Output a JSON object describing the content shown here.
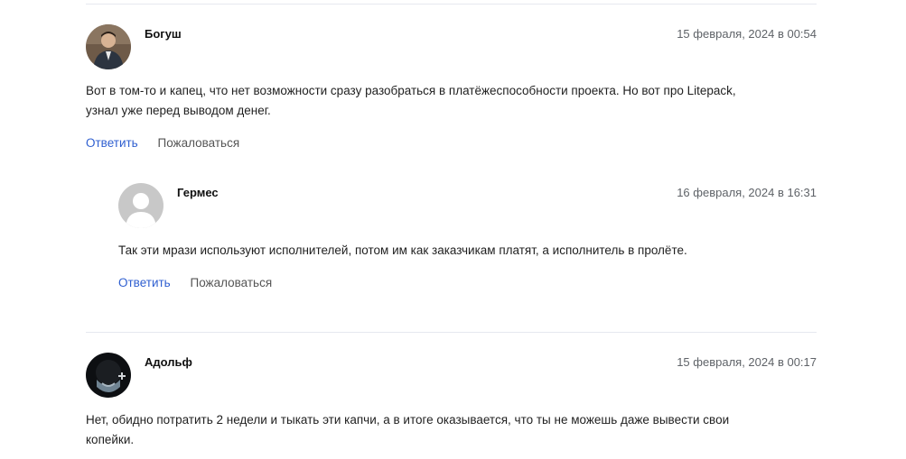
{
  "comments": [
    {
      "author": "Богуш",
      "date": "15 февраля, 2024 в 00:54",
      "text_line1": "Вот в том-то и капец, что нет возможности сразу разобраться в платёжеспособности проекта. Но вот про Litepack,",
      "text_line2": "узнал уже перед выводом денег.",
      "reply_label": "Ответить",
      "report_label": "Пожаловаться"
    },
    {
      "author": "Гермес",
      "date": "16 февраля, 2024 в 16:31",
      "text_line1": "Так эти мрази используют исполнителей, потом им как заказчикам платят, а исполнитель в пролёте.",
      "reply_label": "Ответить",
      "report_label": "Пожаловаться"
    },
    {
      "author": "Адольф",
      "date": "15 февраля, 2024 в 00:17",
      "text_line1": "Нет, обидно потратить 2 недели и тыкать эти капчи, а в итоге оказывается, что ты не можешь даже вывести свои",
      "text_line2": "копейки."
    }
  ],
  "colors": {
    "link": "#2f5fd0",
    "divider": "#e6e8ef",
    "date": "#5f6368"
  },
  "icons": {
    "avatar_default": "default-user-avatar-icon"
  }
}
